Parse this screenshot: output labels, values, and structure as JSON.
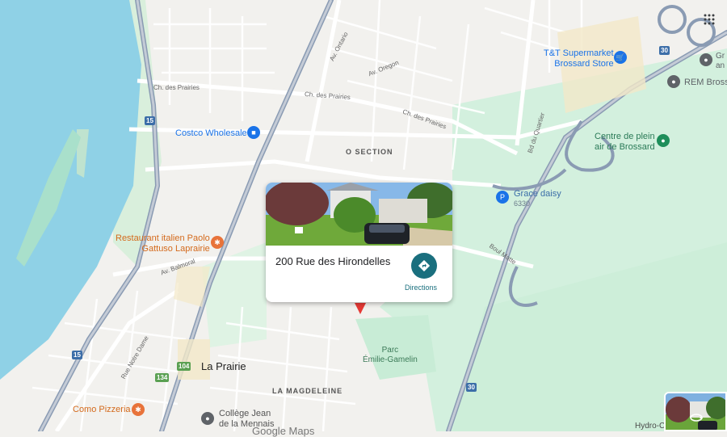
{
  "map": {
    "places": {
      "la_prairie": "La Prairie",
      "la_magdeleine": "LA MAGDELEINE",
      "o_section": "O SECTION",
      "parc": "Parc\nÉmilie-Gamelin",
      "hydro": "Hydro-C"
    },
    "streets": {
      "ch_prairies_1": "Ch. des Prairies",
      "ch_prairies_2": "Ch. des Prairies",
      "ch_prairies_3": "Ch. des Prairies",
      "av_oregon": "Av. Oregon",
      "av_ontario": "Av. Ontario",
      "bd_quartier": "Bd du Quartier",
      "boul_matte": "Boul Matte",
      "av_balmoral": "Av. Balmoral",
      "rue_notre_dame": "Rue Notre Dame"
    },
    "shields": [
      "15",
      "15",
      "30",
      "30",
      "104",
      "134"
    ],
    "pois": {
      "tt": "T&T Supermarket\nBrossard Store",
      "rem": "REM Bross",
      "centre": "Centre de plein\nair de Brossard",
      "grace": "Grace daisy",
      "grace_num": "6330",
      "costco": "Costco Wholesale",
      "paolo": "Restaurant italien Paolo\nGattuso Laprairie",
      "como": "Como Pizzeria",
      "college": "Collège Jean\nde la Mennais",
      "gr": "Gr\nan"
    },
    "wordmark": "Google Maps"
  },
  "card": {
    "address": "200 Rue des Hirondelles",
    "directions_label": "Directions"
  },
  "icons": {
    "directions": "directions-icon",
    "apps": "apps-grid-icon",
    "street_view": "street-view-icon",
    "cart": "shopping-cart-icon",
    "restaurant": "restaurant-icon",
    "place": "place-icon"
  },
  "colors": {
    "water": "#8fd1e6",
    "park": "#c8ecd6",
    "highway": "#8a9bb3",
    "road": "#ffffff",
    "land": "#f2f1ee",
    "marker": "#e53935",
    "directions": "#1a6f7e"
  }
}
